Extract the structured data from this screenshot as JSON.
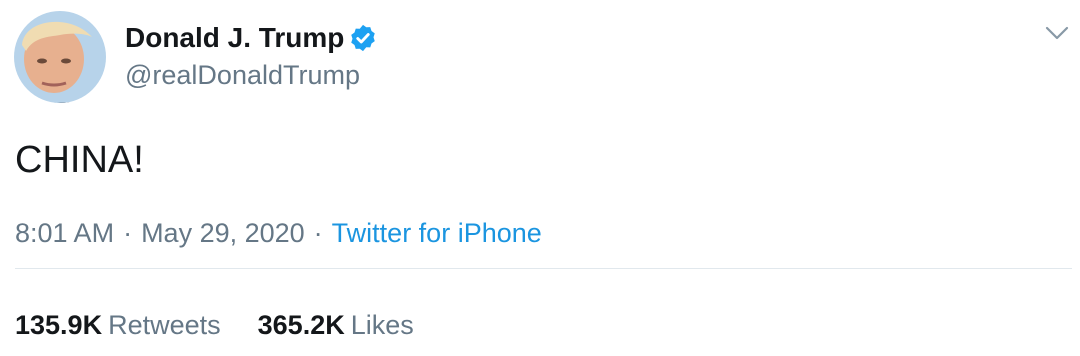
{
  "author": {
    "display_name": "Donald J. Trump",
    "handle": "@realDonaldTrump",
    "verified": true,
    "avatar_icon": "profile-photo"
  },
  "tweet": {
    "text": "CHINA!",
    "time": "8:01 AM",
    "date": "May 29, 2020",
    "separator": "·",
    "source": "Twitter for iPhone"
  },
  "stats": {
    "retweets_count": "135.9K",
    "retweets_label": "Retweets",
    "likes_count": "365.2K",
    "likes_label": "Likes"
  },
  "colors": {
    "text_primary": "#14171a",
    "text_secondary": "#657786",
    "link": "#1b95e0",
    "verified_badge": "#1da1f2",
    "divider": "#e1e8ed"
  }
}
